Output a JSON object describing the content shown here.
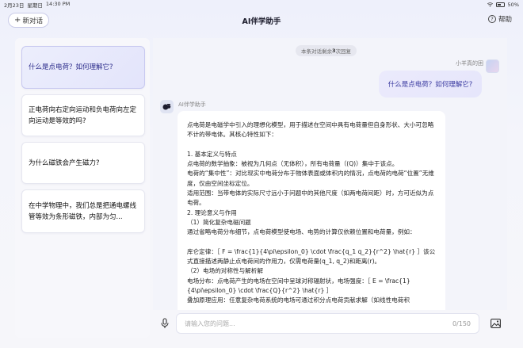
{
  "statusbar": {
    "date": "2月23日",
    "weekday": "星期日",
    "time": "14:30 PM",
    "battery": "50%"
  },
  "header": {
    "new_chat_label": "新对话",
    "title": "AI伴学助手",
    "help_label": "帮助"
  },
  "sidebar": {
    "items": [
      {
        "label": "什么是点电荷？如何理解它?",
        "active": true
      },
      {
        "label": "正电荷向右定向运动和负电荷向左定向运动是等效的吗?"
      },
      {
        "label": "为什么磁铁会产生磁力?"
      },
      {
        "label": "在中学物理中，我们总是把通电螺线管等效为条形磁铁，内部为匀..."
      }
    ]
  },
  "chat": {
    "limit_prefix": "本条对话剩余",
    "limit_count": "3",
    "limit_suffix": "次回复",
    "user_name": "小羊真的困",
    "user_message": "什么是点电荷？如何理解它?",
    "ai_name": "AI伴学助手",
    "ai_paragraphs": [
      "点电荷是电磁学中引入的理想化模型，用于描述在空间中具有电荷量但自身形状、大小可忽略不计的带电体。其核心特性如下：",
      "",
      "1. 基本定义与特点",
      "点电荷的数学抽象：被视为几何点（无体积），所有电荷量（(Q)）集中于该点。",
      "电荷的“集中性”：对比现实中电荷分布于物体表面或体积内的情况，点电荷的电荷“位置”无维度，仅由空间坐标定位。",
      "适用范围：当带电体的实际尺寸远小于问题中的其他尺度（如两电荷间距）时，方可近似为点电荷。",
      "2. 理论意义与作用",
      "（1）简化复杂电磁问题",
      "通过省略电荷分布细节，点电荷模型使电场、电势的计算仅依赖位置和电荷量，例如：",
      "",
      "库仑定律：［ F = \\frac{1}{4\\pi\\epsilon_0} \\cdot \\frac{q_1 q_2}{r^2} \\hat{r} ］该公式直接描述两静止点电荷间的作用力，仅需电荷量(q_1, q_2)和距离(r)。",
      "（2）电场的对称性与解析解",
      "电场分布：点电荷产生的电场在空间中呈球对称辐射状，电场强度：［ E = \\frac{1}{4\\pi\\epsilon_0} \\cdot \\frac{Q}{r^2} \\hat{r} ］",
      "叠加原理应用：任意复杂电荷系统的电场可通过积分点电荷贡献求解（如线性电荷积"
    ]
  },
  "input": {
    "placeholder": "请输入您的问题...",
    "counter": "0/150"
  },
  "colors": {
    "accent": "#3a3aa0",
    "active_card": "#e3e4fb"
  },
  "icons": [
    "wifi-icon",
    "battery-icon",
    "plus-icon",
    "help-icon",
    "ai-avatar-icon",
    "mic-icon",
    "image-icon"
  ]
}
